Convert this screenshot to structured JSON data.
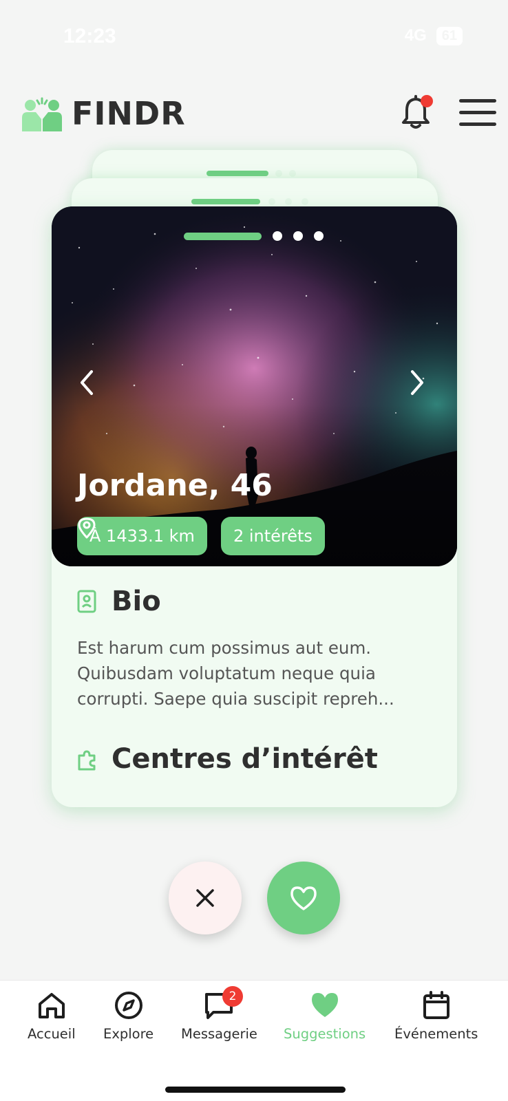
{
  "status_bar": {
    "time": "12:23",
    "network": "4G",
    "battery": "61"
  },
  "header": {
    "brand": "FINDR",
    "brand_color": "#6fcf83",
    "icons": [
      "logo-icon",
      "bell-icon",
      "menu-icon"
    ],
    "notification_dot": true
  },
  "profile": {
    "name_age": "Jordane, 46",
    "photo_index": 1,
    "photo_count": 4,
    "distance": "À 1433.1 km",
    "interests_count": "2 intérêts",
    "bio_heading": "Bio",
    "bio_text": "Est harum cum possimus aut eum. Quibusdam voluptatum neque quia corrupti. Saepe quia suscipit repreh...",
    "interests_heading": "Centres d’intérêt"
  },
  "actions": {
    "pass_icon": "close-icon",
    "like_icon": "heart-icon"
  },
  "bottom_nav": {
    "items": [
      {
        "label": "Accueil",
        "icon": "home-icon"
      },
      {
        "label": "Explore",
        "icon": "compass-icon"
      },
      {
        "label": "Messagerie",
        "icon": "chat-icon",
        "badge": "2"
      },
      {
        "label": "Suggestions",
        "icon": "heart-icon",
        "active": true
      },
      {
        "label": "Événements",
        "icon": "calendar-icon"
      }
    ]
  },
  "colors": {
    "accent": "#6fcf83",
    "badge": "#ef3b33",
    "card_bg": "#f1fbf2"
  }
}
